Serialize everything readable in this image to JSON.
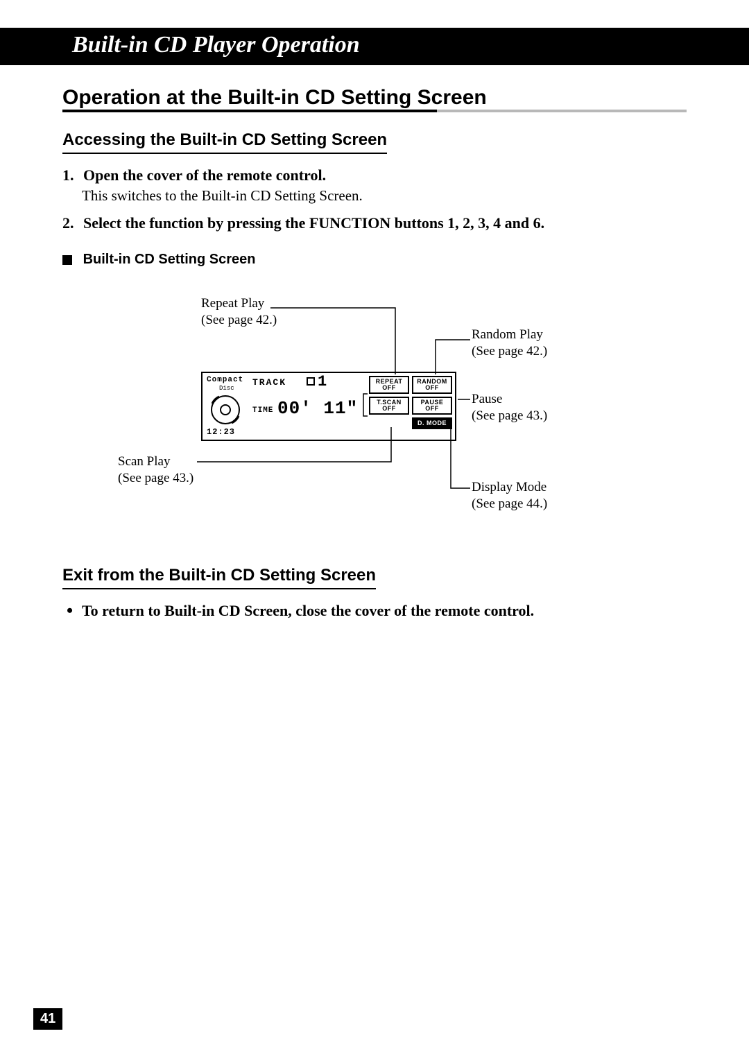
{
  "banner": "Built-in CD Player Operation",
  "h1": "Operation at the Built-in CD Setting Screen",
  "access": {
    "heading": "Accessing the Built-in CD Setting Screen",
    "steps": [
      {
        "num": "1.",
        "title": "Open the cover of the remote control.",
        "desc": "This switches to the Built-in CD Setting Screen."
      },
      {
        "num": "2.",
        "title": "Select the function by pressing the FUNCTION buttons 1, 2, 3, 4 and 6.",
        "desc": ""
      }
    ],
    "subheading": "Built-in CD Setting Screen"
  },
  "diagram": {
    "callouts": {
      "repeat": {
        "line1": "Repeat Play",
        "line2": "(See page 42.)"
      },
      "random": {
        "line1": "Random Play",
        "line2": "(See page 42.)"
      },
      "pause": {
        "line1": "Pause",
        "line2": "(See page 43.)"
      },
      "scan": {
        "line1": "Scan Play",
        "line2": "(See page 43.)"
      },
      "dmode": {
        "line1": "Display Mode",
        "line2": "(See page 44.)"
      }
    },
    "lcd": {
      "compact1": "Compact",
      "compact2": "Disc",
      "track_label": "TRACK",
      "track_num": "1",
      "time_label": "TIME",
      "time_value": "00' 11\"",
      "clock": "12:23",
      "buttons": {
        "repeat": "REPEAT",
        "repeat_state": "OFF",
        "random": "RANDOM",
        "random_state": "OFF",
        "tscan": "T.SCAN",
        "tscan_state": "OFF",
        "pause": "PAUSE",
        "pause_state": "OFF",
        "dmode": "D. MODE"
      }
    }
  },
  "exit": {
    "heading": "Exit from the Built-in CD Setting Screen",
    "bullet": "To return to Built-in CD Screen, close the cover of the remote control."
  },
  "page_number": "41"
}
